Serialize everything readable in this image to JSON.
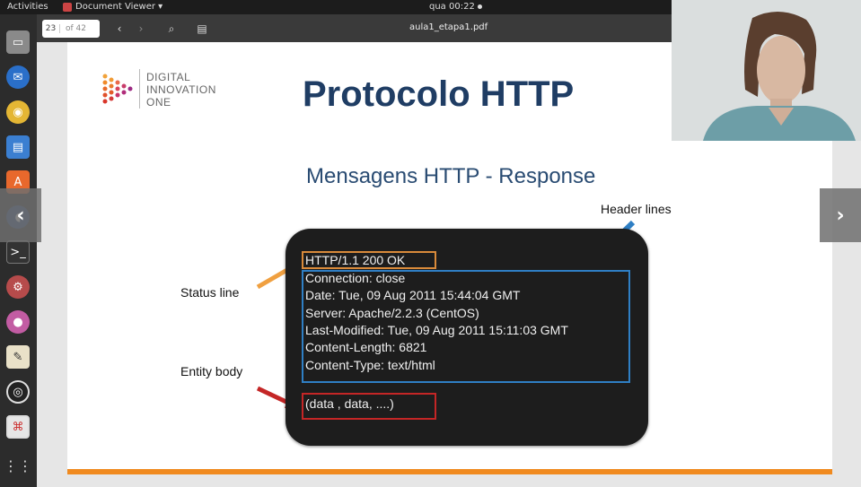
{
  "topbar": {
    "activities": "Activities",
    "app_menu": "Document Viewer ▾",
    "clock": "qua 00:22"
  },
  "dock": {
    "items": [
      "files-app",
      "thunderbird-app",
      "rhythmbox-app",
      "libreoffice-writer-app",
      "software-center-app",
      "sound-app",
      "terminal-app",
      "settings-app",
      "screenshot-app",
      "text-editor-app",
      "obs-app",
      "document-viewer-app",
      "apps-grid"
    ]
  },
  "toolbar": {
    "page_current": "23",
    "page_total": "of 42",
    "document_title": "aula1_etapa1.pdf"
  },
  "slide": {
    "logo_line1": "DIGITAL",
    "logo_line2": "INNOVATION",
    "logo_line3": "ONE",
    "title": "Protocolo HTTP",
    "subtitle": "Mensagens HTTP - Response",
    "label_status": "Status line",
    "label_header": "Header lines",
    "label_entity": "Entity body",
    "lines": [
      "HTTP/1.1 200 OK",
      "Connection: close",
      "Date: Tue, 09 Aug 2011 15:44:04 GMT",
      "Server: Apache/2.2.3 (CentOS)",
      "Last-Modified: Tue, 09 Aug 2011 15:11:03 GMT",
      "Content-Length: 6821",
      "Content-Type: text/html"
    ],
    "entity": "(data , data, ....)"
  },
  "colors": {
    "title": "#1f3d64",
    "status_accent": "#d98a3a",
    "header_accent": "#2f7fc4",
    "entity_accent": "#c42626",
    "bottom_bar": "#f08a1f"
  },
  "nav": {
    "prev": "‹",
    "next": "›"
  }
}
